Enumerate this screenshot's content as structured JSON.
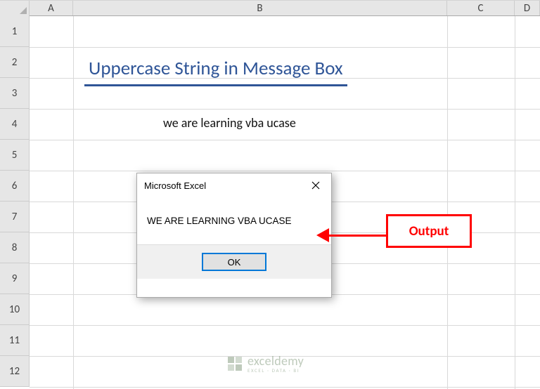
{
  "columns": [
    "A",
    "B",
    "C",
    "D"
  ],
  "rows": [
    "1",
    "2",
    "3",
    "4",
    "5",
    "6",
    "7",
    "8",
    "9",
    "10",
    "11",
    "12"
  ],
  "title_cell": "Uppercase String in Message Box",
  "input_cell": "we are learning vba ucase",
  "dialog": {
    "title": "Microsoft Excel",
    "message": "WE ARE LEARNING VBA UCASE",
    "ok_label": "OK"
  },
  "callout_label": "Output",
  "watermark": {
    "brand": "exceldemy",
    "tagline": "EXCEL · DATA · BI"
  }
}
